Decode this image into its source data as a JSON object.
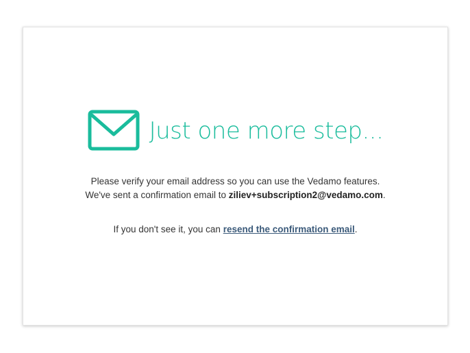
{
  "verify": {
    "title": "Just one more step...",
    "line1": "Please verify your email address so you can use the Vedamo features.",
    "line2_prefix": "We've sent a confirmation email to ",
    "email": "ziliev+subscription2@vedamo.com",
    "line2_suffix": ".",
    "resend_prefix": "If you don't see it, you can ",
    "resend_link": "resend the confirmation email",
    "resend_suffix": "."
  },
  "colors": {
    "accent": "#1abc9c",
    "link": "#3b5a7a",
    "text": "#333333"
  },
  "icons": {
    "envelope": "envelope-icon"
  }
}
